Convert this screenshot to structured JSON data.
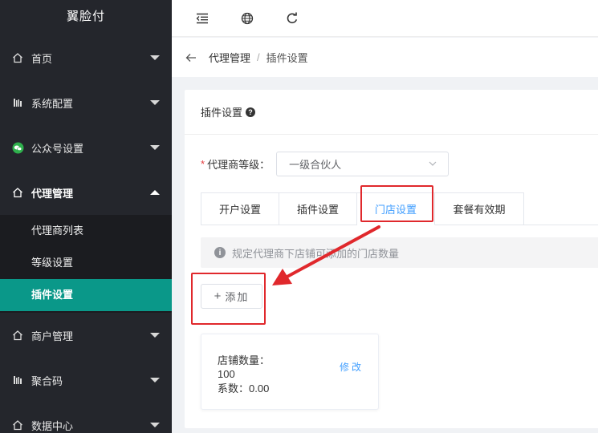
{
  "app": {
    "title": "翼脸付"
  },
  "sidebar": {
    "items": [
      {
        "label": "首页",
        "icon": "home-icon"
      },
      {
        "label": "系统配置",
        "icon": "config-icon"
      },
      {
        "label": "公众号设置",
        "icon": "wechat-icon"
      },
      {
        "label": "代理管理",
        "icon": "home-icon",
        "open": true
      },
      {
        "label": "商户管理",
        "icon": "home-icon"
      },
      {
        "label": "聚合码",
        "icon": "config-icon"
      },
      {
        "label": "数据中心",
        "icon": "home-icon"
      }
    ],
    "submenu": [
      {
        "label": "代理商列表"
      },
      {
        "label": "等级设置"
      },
      {
        "label": "插件设置",
        "active": true
      }
    ]
  },
  "topbar": {
    "icons": [
      "collapse-menu-icon",
      "globe-icon",
      "refresh-icon"
    ]
  },
  "breadcrumb": {
    "items": [
      "代理管理",
      "插件设置"
    ],
    "separator": "/"
  },
  "card": {
    "title": "插件设置",
    "form": {
      "required_mark": "*",
      "label": "代理商等级：",
      "selected": "一级合伙人"
    },
    "tabs": [
      {
        "label": "开户设置"
      },
      {
        "label": "插件设置"
      },
      {
        "label": "门店设置",
        "active": true
      },
      {
        "label": "套餐有效期"
      }
    ],
    "alert": {
      "text": "规定代理商下店铺可添加的门店数量"
    },
    "add_button": {
      "plus": "+",
      "label": "添加"
    },
    "store": {
      "count_label": "店铺数量：",
      "count_value": "100",
      "coef_text": "系数：0.00",
      "edit_label": "修改"
    }
  },
  "colors": {
    "sidebar_bg": "#24262c",
    "submenu_bg": "#1b1c20",
    "active_green": "#0a9889",
    "accent_blue": "#409eff",
    "annotation_red": "#e0282c"
  }
}
